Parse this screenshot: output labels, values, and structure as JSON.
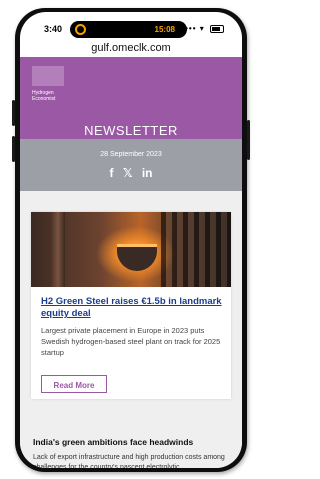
{
  "status_bar": {
    "time": "3:40",
    "island_timer": "15:08",
    "icons": "••• ▾"
  },
  "browser": {
    "url": "gulf.omeclk.com"
  },
  "header": {
    "logo_text": "Hydrogen Economist",
    "title": "NEWSLETTER",
    "brand_color": "#9b58a5"
  },
  "date_band": {
    "date": "28 September 2023",
    "social": [
      {
        "icon": "facebook-icon",
        "glyph": "f"
      },
      {
        "icon": "x-icon",
        "glyph": "𝕏"
      },
      {
        "icon": "linkedin-icon",
        "glyph": "in"
      }
    ]
  },
  "article": {
    "title": "H2 Green Steel raises €1.5b in landmark equity deal",
    "description": "Largest private placement in Europe in 2023 puts Swedish hydrogen-based steel plant on track for 2025 startup",
    "button": "Read More"
  },
  "next_section": {
    "title": "India's green ambitions face headwinds",
    "text": "Lack of export infrastructure and high production costs among challenges for the country's nascent electrolytic"
  }
}
